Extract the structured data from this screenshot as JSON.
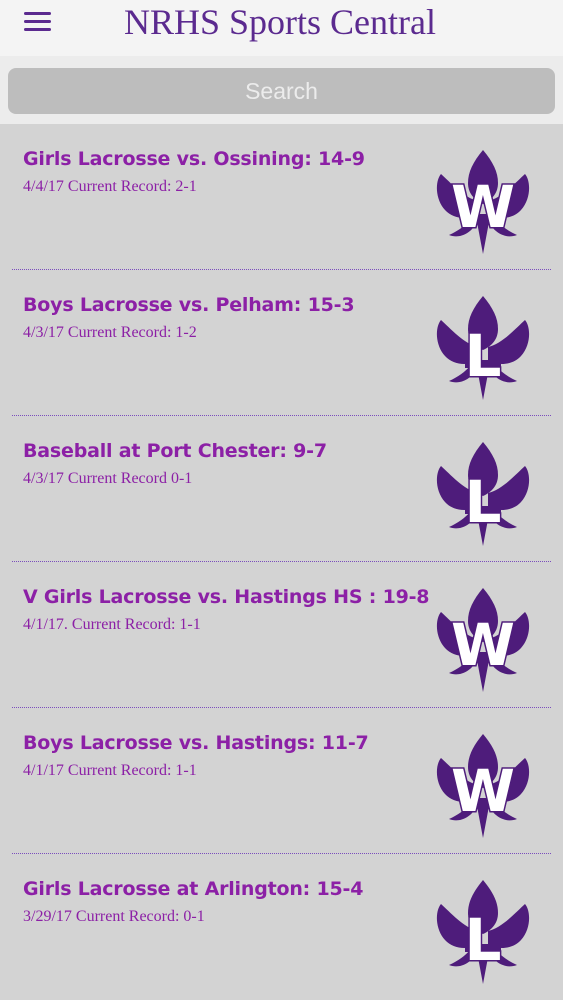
{
  "header": {
    "title": "NRHS Sports Central",
    "menu_icon": "hamburger-menu-icon"
  },
  "search": {
    "placeholder": "Search",
    "value": ""
  },
  "colors": {
    "accent": "#5b2a8f",
    "item_text": "#8c20a6",
    "badge_fill": "#4e1c7b",
    "background": "#d3d3d3"
  },
  "items": [
    {
      "title": "Girls Lacrosse vs. Ossining: 14-9",
      "subtitle": "4/4/17  Current Record: 2-1",
      "result": "W",
      "icon": "fleur-de-lis-win-icon"
    },
    {
      "title": "Boys Lacrosse vs. Pelham: 15-3",
      "subtitle": "4/3/17  Current Record: 1-2",
      "result": "L",
      "icon": "fleur-de-lis-loss-icon"
    },
    {
      "title": "Baseball at Port Chester: 9-7",
      "subtitle": "4/3/17  Current Record 0-1",
      "result": "L",
      "icon": "fleur-de-lis-loss-icon"
    },
    {
      "title": "V Girls Lacrosse vs. Hastings HS : 19-8",
      "subtitle": "4/1/17.  Current Record: 1-1",
      "result": "W",
      "icon": "fleur-de-lis-win-icon"
    },
    {
      "title": "Boys Lacrosse vs. Hastings: 11-7",
      "subtitle": "4/1/17 Current Record: 1-1",
      "result": "W",
      "icon": "fleur-de-lis-win-icon"
    },
    {
      "title": "Girls Lacrosse at Arlington: 15-4",
      "subtitle": "3/29/17 Current Record: 0-1",
      "result": "L",
      "icon": "fleur-de-lis-loss-icon"
    }
  ]
}
